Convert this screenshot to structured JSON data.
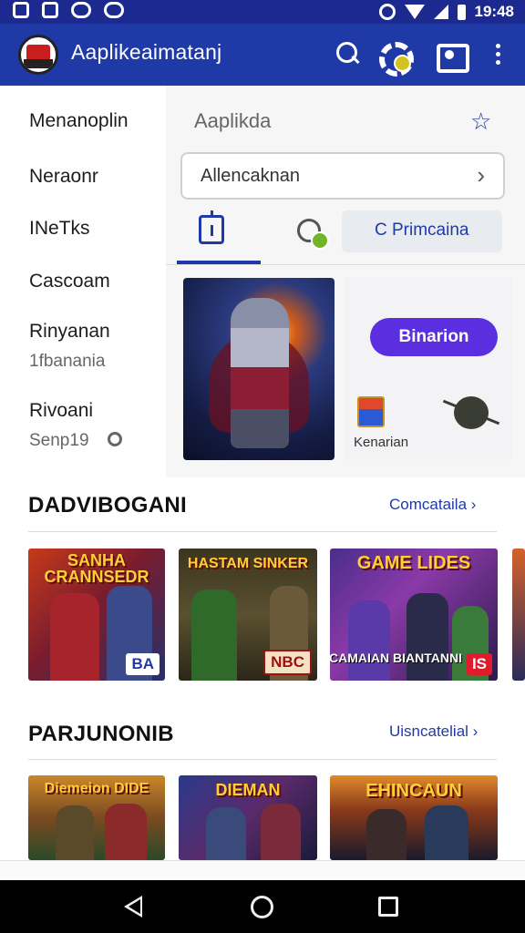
{
  "status_bar": {
    "time": "19:48"
  },
  "app_bar": {
    "title": "Aaplikeaimatanj"
  },
  "drawer": {
    "items": [
      {
        "label": "Menanoplin"
      },
      {
        "label": "Neraonr"
      },
      {
        "label": "INeTks"
      },
      {
        "label": "Cascoam"
      },
      {
        "label": "Rinyanan",
        "sub": "1fbanania"
      },
      {
        "label": "Rivoani",
        "sub": "Senp19"
      }
    ]
  },
  "panel": {
    "title": "Aaplikda",
    "search_text": "Allencaknan",
    "tab_c_label": "C Primcaina",
    "promo_button": "Binarion",
    "promo_caption": "Kenarian"
  },
  "sections": [
    {
      "title": "DADVIBOGANI",
      "link": "Comcataila",
      "cards": [
        {
          "title": "SANHA CRANNSEDR",
          "badge": "BA"
        },
        {
          "title": "HASTAM  SINKER",
          "badge": "NBC"
        },
        {
          "title": "GAME LIDES",
          "subtitle": "CAMAIAN BIANTANNI",
          "badge": "IS"
        }
      ]
    },
    {
      "title": "PARJUNONIB",
      "link": "Uisncatelial",
      "cards": [
        {
          "title": "Diemeion DIDE"
        },
        {
          "title": "DIEMAN"
        },
        {
          "title": "EHINCAUN"
        }
      ]
    }
  ],
  "colors": {
    "primary": "#1f3aa6",
    "status_bar": "#1c2a8f",
    "promo": "#5b2fe0"
  }
}
